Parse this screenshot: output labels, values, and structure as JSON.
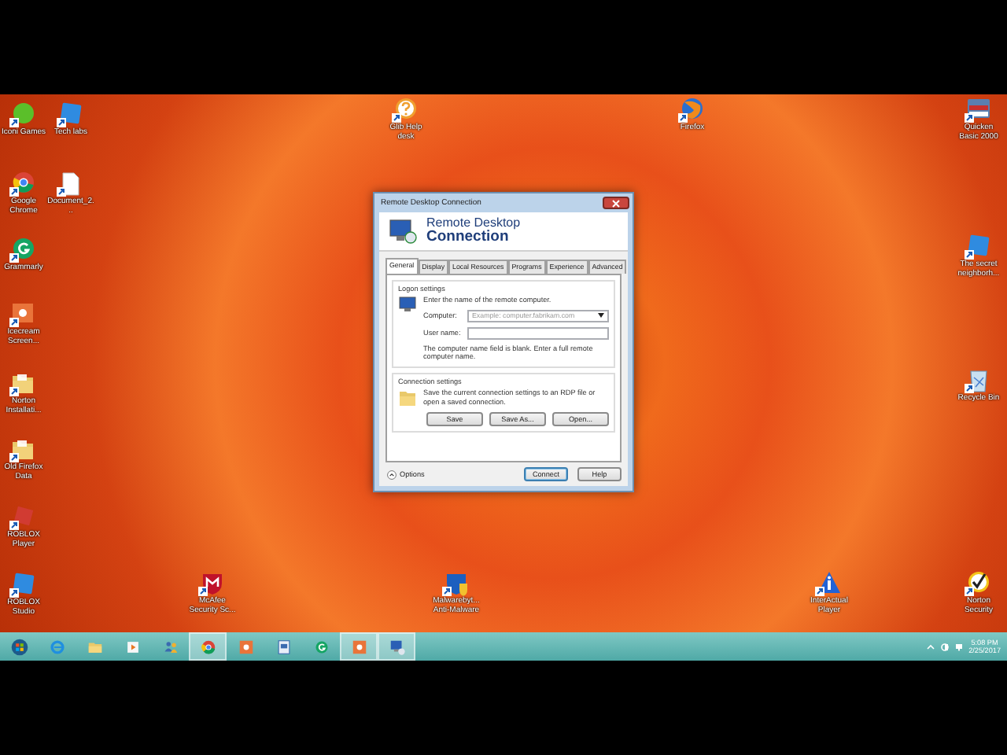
{
  "desktop": {
    "icons": [
      {
        "label": "Iconi Games",
        "kind": "ball"
      },
      {
        "label": "Tech labs",
        "kind": "tile"
      },
      {
        "label": "Glib Help desk",
        "kind": "help"
      },
      {
        "label": "Firefox",
        "kind": "globe"
      },
      {
        "label": "Quicken Basic 2000",
        "kind": "card"
      },
      {
        "label": "Google Chrome",
        "kind": "chrome"
      },
      {
        "label": "Document_2...",
        "kind": "page"
      },
      {
        "label": "Grammarly",
        "kind": "grammar"
      },
      {
        "label": "The secret neighborh...",
        "kind": "tile"
      },
      {
        "label": "Icecream Screen...",
        "kind": "camera"
      },
      {
        "label": "Norton Installati...",
        "kind": "folder"
      },
      {
        "label": "Recycle Bin",
        "kind": "bin"
      },
      {
        "label": "Old Firefox Data",
        "kind": "folder"
      },
      {
        "label": "ROBLOX Player",
        "kind": "roblox"
      },
      {
        "label": "ROBLOX Studio",
        "kind": "tile"
      },
      {
        "label": "McAfee Security Sc...",
        "kind": "shield"
      },
      {
        "label": "Malwarebyt... Anti-Malware",
        "kind": "malware"
      },
      {
        "label": "InterActual Player",
        "kind": "triangle"
      },
      {
        "label": "Norton Security",
        "kind": "check"
      }
    ]
  },
  "dialog": {
    "title": "Remote Desktop Connection",
    "heading_line1": "Remote Desktop",
    "heading_line2": "Connection",
    "tabs": [
      {
        "label": "General",
        "selected": true
      },
      {
        "label": "Display",
        "selected": false
      },
      {
        "label": "Local Resources",
        "selected": false
      },
      {
        "label": "Programs",
        "selected": false
      },
      {
        "label": "Experience",
        "selected": false
      },
      {
        "label": "Advanced",
        "selected": false
      }
    ],
    "logon": {
      "legend": "Logon settings",
      "prompt": "Enter the name of the remote computer.",
      "computer": {
        "label": "Computer:",
        "placeholder": "Example: computer.fabrikam.com"
      },
      "username": {
        "label": "User name:"
      },
      "note": "The computer name field is blank. Enter a full remote computer name."
    },
    "connection": {
      "legend": "Connection settings",
      "text": "Save the current connection settings to an RDP file or open a saved connection.",
      "buttons": [
        "Save",
        "Save As...",
        "Open..."
      ]
    },
    "options": "Options",
    "buttons": [
      "Connect",
      "Help"
    ]
  },
  "taskbar": {
    "items": [
      {
        "kind": "start",
        "active": false
      },
      {
        "kind": "ie",
        "active": false
      },
      {
        "kind": "explorer",
        "active": false
      },
      {
        "kind": "media",
        "active": false
      },
      {
        "kind": "people",
        "active": false
      },
      {
        "kind": "chrome",
        "active": true
      },
      {
        "kind": "camera",
        "active": false
      },
      {
        "kind": "doc",
        "active": false
      },
      {
        "kind": "grammar",
        "active": false
      },
      {
        "kind": "camera",
        "active": true
      },
      {
        "kind": "rdp",
        "active": true
      }
    ],
    "time": "5:08 PM",
    "date": "2/25/2017"
  }
}
